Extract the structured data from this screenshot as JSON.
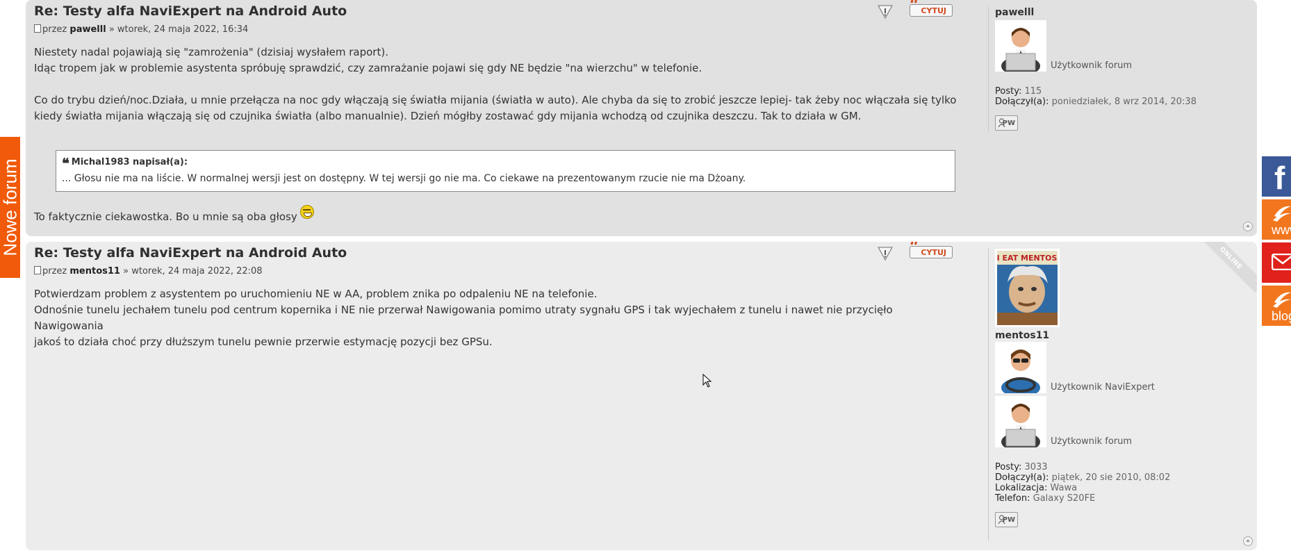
{
  "side_tab": {
    "label": "Nowe forum"
  },
  "social": [
    {
      "name": "facebook",
      "label": "f",
      "color": "#3b5998"
    },
    {
      "name": "www",
      "label": "www",
      "color": "#f2761e"
    },
    {
      "name": "mail",
      "label": "",
      "color": "#e0211c"
    },
    {
      "name": "blog",
      "label": "blog",
      "color": "#f2761e"
    }
  ],
  "buttons": {
    "quote": "CYTUJ",
    "pm": "PW"
  },
  "posts": [
    {
      "title": "Re: Testy alfa NaviExpert na Android Auto",
      "by": "przez",
      "author": "pawelll",
      "date": "» wtorek, 24 maja 2022, 16:34",
      "lines": [
        "Niestety nadal pojawiają się \"zamrożenia\" (dzisiaj wysłałem raport).",
        "Idąc tropem jak w problemie asystenta spróbuję sprawdzić, czy zamrażanie pojawi się gdy NE będzie \"na wierzchu\" w telefonie.",
        "Co do trybu dzień/noc.Działa, u mnie przełącza na noc gdy włączają się światła mijania (światła w auto). Ale chyba da się to zrobić jeszcze lepiej- tak żeby noc włączała się tylko",
        "kiedy światła mijania włączają się od czujnika światła (albo manualnie). Dzień mógłby zostawać gdy mijania wchodzą od czujnika deszczu. Tak to działa w GM."
      ],
      "quote": {
        "cite": "Michal1983 napisał(a):",
        "text": "... Głosu nie ma na liście. W normalnej wersji jest on dostępny. W tej wersji go nie ma. Co ciekawe na prezentowanym rzucie nie ma Dżoany."
      },
      "after_quote": "To faktycznie ciekawostka. Bo u mnie są oba głosy",
      "profile": {
        "username": "pawelll",
        "rank": "Użytkownik forum",
        "posts_label": "Posty:",
        "posts": "115",
        "joined_label": "Dołączył(a):",
        "joined": "poniedziałek, 8 wrz 2014, 20:38"
      }
    },
    {
      "title": "Re: Testy alfa NaviExpert na Android Auto",
      "by": "przez",
      "author": "mentos11",
      "date": "» wtorek, 24 maja 2022, 22:08",
      "lines": [
        "Potwierdzam problem z asystentem po uruchomieniu NE w AA, problem znika po odpaleniu NE na telefonie.",
        "Odnośnie tunelu jechałem tunelu pod centrum kopernika i NE nie przerwał Nawigowania pomimo utraty sygnału GPS i tak wyjechałem z tunelu i nawet nie przycięło Nawigowania",
        "jakoś to działa choć przy dłuższym tunelu pewnie przerwie estymację pozycji bez GPSu."
      ],
      "online_label": "ONLINE",
      "profile": {
        "username": "mentos11",
        "rank1": "Użytkownik NaviExpert",
        "rank2": "Użytkownik forum",
        "posts_label": "Posty:",
        "posts": "3033",
        "joined_label": "Dołączył(a):",
        "joined": "piątek, 20 sie 2010, 08:02",
        "location_label": "Lokalizacja:",
        "location": "Wawa",
        "phone_label": "Telefon:",
        "phone": "Galaxy S20FE"
      }
    }
  ]
}
